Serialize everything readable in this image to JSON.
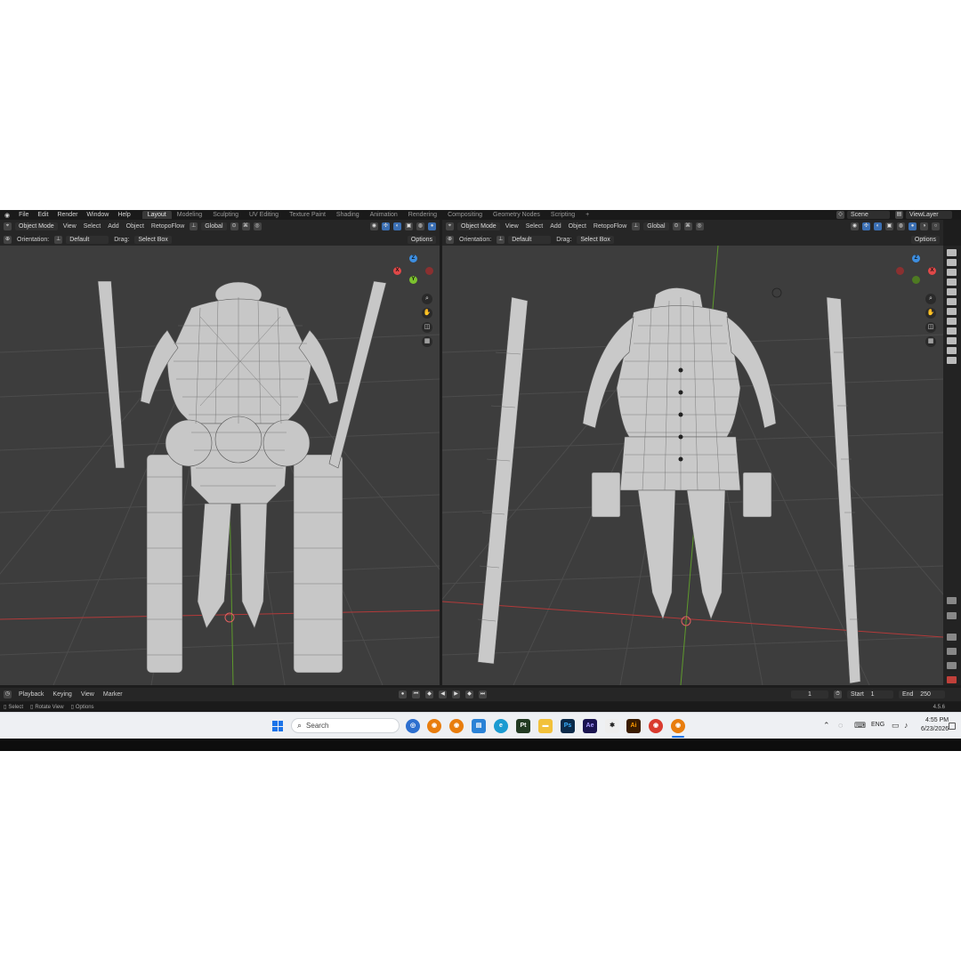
{
  "menu": [
    "File",
    "Edit",
    "Render",
    "Window",
    "Help"
  ],
  "workspace_tabs": [
    {
      "label": "Layout",
      "active": true
    },
    {
      "label": "Modeling",
      "active": false
    },
    {
      "label": "Sculpting",
      "active": false
    },
    {
      "label": "UV Editing",
      "active": false
    },
    {
      "label": "Texture Paint",
      "active": false
    },
    {
      "label": "Shading",
      "active": false
    },
    {
      "label": "Animation",
      "active": false
    },
    {
      "label": "Rendering",
      "active": false
    },
    {
      "label": "Compositing",
      "active": false
    },
    {
      "label": "Geometry Nodes",
      "active": false
    },
    {
      "label": "Scripting",
      "active": false
    }
  ],
  "add_workspace": "+",
  "scene": "Scene",
  "view_layer": "ViewLayer",
  "left_header": {
    "mode": "Object Mode",
    "view": "View",
    "select": "Select",
    "add": "Add",
    "object": "Object",
    "addon": "RetopoFlow",
    "transform": "Global",
    "orientation_label": "Orientation:",
    "orientation_value": "Default",
    "drag_label": "Drag:",
    "drag_value": "Select Box",
    "options": "Options"
  },
  "right_header": {
    "mode": "Object Mode",
    "view": "View",
    "select": "Select",
    "add": "Add",
    "object": "Object",
    "addon": "RetopoFlow",
    "transform": "Global",
    "orientation_label": "Orientation:",
    "orientation_value": "Default",
    "drag_label": "Drag:",
    "drag_value": "Select Box",
    "options": "Options"
  },
  "gizmo": {
    "z": "Z",
    "y": "Y",
    "x": "X"
  },
  "timeline": {
    "playback": "Playback",
    "keying": "Keying",
    "view": "View",
    "marker": "Marker",
    "current_frame": "1",
    "start_label": "Start",
    "start": "1",
    "end_label": "End",
    "end": "250"
  },
  "status": {
    "select": "Select",
    "rotate": "Rotate View",
    "options": "Options",
    "version": "4.5.6"
  },
  "taskbar": {
    "search_placeholder": "Search",
    "language": "ENG",
    "time": "4:55 PM",
    "date": "6/23/2026"
  },
  "colors": {
    "viewport_bg": "#3d3d3d",
    "axis_x": "#c23b3b",
    "axis_y": "#6a9e2e",
    "gizmo_x": "#e04848",
    "gizmo_y": "#7cc22e",
    "gizmo_z": "#3d8ee0"
  }
}
